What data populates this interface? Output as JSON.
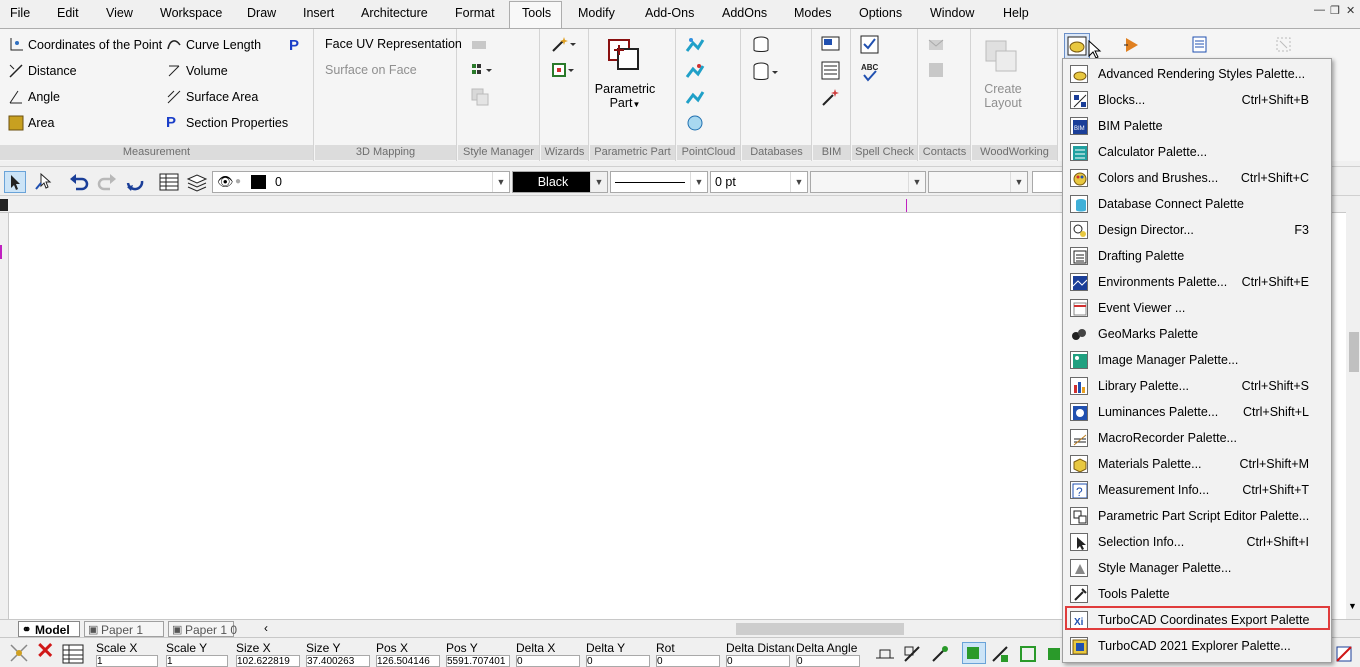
{
  "menubar": {
    "items": [
      "File",
      "Edit",
      "View",
      "Workspace",
      "Draw",
      "Insert",
      "Architecture",
      "Format",
      "Tools",
      "Modify",
      "Add-Ons",
      "AddOns",
      "Modes",
      "Options",
      "Window",
      "Help"
    ],
    "active": "Tools"
  },
  "ribbon": {
    "measurement": {
      "label": "Measurement",
      "items": [
        "Coordinates of the Point",
        "Distance",
        "Angle",
        "Area",
        "Curve Length",
        "Volume",
        "Surface Area",
        "Section Properties"
      ]
    },
    "mapping": {
      "label": "3D Mapping",
      "items": [
        "Face UV Representation",
        "Surface on Face"
      ]
    },
    "style_manager": {
      "label": "Style Manager"
    },
    "wizards": {
      "label": "Wizards"
    },
    "parametric": {
      "label": "Parametric Part",
      "button": "Parametric",
      "button2": "Part"
    },
    "pointcloud": {
      "label": "PointCloud"
    },
    "databases": {
      "label": "Databases"
    },
    "bim": {
      "label": "BIM"
    },
    "spell": {
      "label": "Spell Check"
    },
    "contacts": {
      "label": "Contacts"
    },
    "woodworking": {
      "label": "WoodWorking",
      "button": "Create",
      "button2": "Layout"
    }
  },
  "toolbar": {
    "layer_value": "0",
    "color_value": "Black",
    "pen_width": "0 pt"
  },
  "bottom_tabs": [
    "Model",
    "Paper 1",
    "Paper 1 0"
  ],
  "status": {
    "labels": [
      "Scale X",
      "Scale Y",
      "Size X",
      "Size Y",
      "Pos X",
      "Pos Y",
      "Delta X",
      "Delta Y",
      "Rot",
      "Delta Distance",
      "Delta Angle"
    ],
    "values": [
      "1",
      "1",
      "102.622819",
      "37.400263",
      "126.504146",
      "5591.707401",
      "0",
      "0",
      "0",
      "0",
      "0"
    ]
  },
  "dropdown": {
    "items": [
      {
        "label": "Advanced Rendering Styles Palette...",
        "shortcut": ""
      },
      {
        "label": "Blocks...",
        "shortcut": "Ctrl+Shift+B"
      },
      {
        "label": "BIM Palette",
        "shortcut": ""
      },
      {
        "label": "Calculator Palette...",
        "shortcut": ""
      },
      {
        "label": "Colors and Brushes...",
        "shortcut": "Ctrl+Shift+C"
      },
      {
        "label": "Database Connect Palette",
        "shortcut": ""
      },
      {
        "label": "Design Director...",
        "shortcut": "F3"
      },
      {
        "label": "Drafting Palette",
        "shortcut": ""
      },
      {
        "label": "Environments Palette...",
        "shortcut": "Ctrl+Shift+E"
      },
      {
        "label": "Event Viewer ...",
        "shortcut": ""
      },
      {
        "label": "GeoMarks Palette",
        "shortcut": ""
      },
      {
        "label": "Image Manager Palette...",
        "shortcut": ""
      },
      {
        "label": "Library Palette...",
        "shortcut": "Ctrl+Shift+S"
      },
      {
        "label": "Luminances Palette...",
        "shortcut": "Ctrl+Shift+L"
      },
      {
        "label": "MacroRecorder Palette...",
        "shortcut": ""
      },
      {
        "label": "Materials Palette...",
        "shortcut": "Ctrl+Shift+M"
      },
      {
        "label": "Measurement Info...",
        "shortcut": "Ctrl+Shift+T"
      },
      {
        "label": "Parametric Part Script Editor Palette...",
        "shortcut": ""
      },
      {
        "label": "Selection Info...",
        "shortcut": "Ctrl+Shift+I"
      },
      {
        "label": "Style Manager Palette...",
        "shortcut": ""
      },
      {
        "label": "Tools Palette",
        "shortcut": ""
      },
      {
        "label": "TurboCAD Coordinates Export Palette",
        "shortcut": ""
      },
      {
        "label": "TurboCAD 2021 Explorer Palette...",
        "shortcut": ""
      }
    ],
    "highlighted_index": 21,
    "highlight_color": "#e03c3c"
  }
}
